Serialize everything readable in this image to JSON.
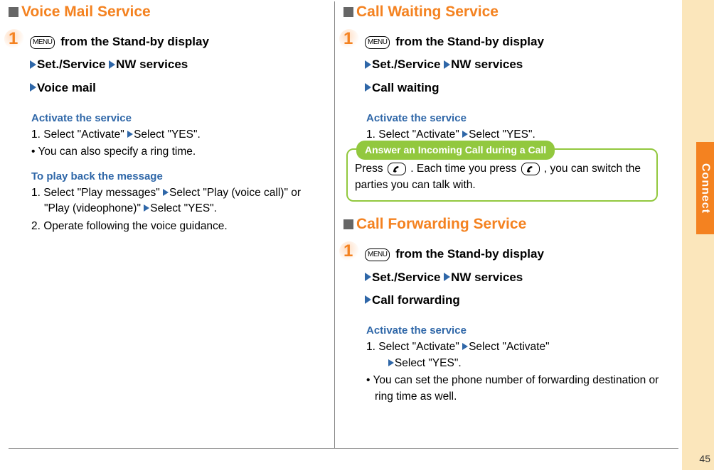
{
  "page_number": "45",
  "side_tab": "Connect",
  "menu_label": "MENU",
  "left": {
    "section_title": "Voice Mail Service",
    "step1": {
      "num": "1",
      "line1_after_menu": "from the Stand-by display",
      "part1": "Set./Service",
      "part2": "NW services",
      "part3": "Voice mail"
    },
    "sub1": {
      "title": "Activate the service",
      "item1": "1. Select \"Activate\"",
      "item1_after": "Select \"YES\".",
      "note": " • You can also specify a ring time."
    },
    "sub2": {
      "title": "To play back the message",
      "item1": "1. Select \"Play messages\"",
      "item1_after": "Select \"Play (voice call)\" or \"Play (videophone)\"",
      "item1_after2": "Select \"YES\".",
      "item2": "2. Operate following the voice guidance."
    }
  },
  "right": {
    "sectionA_title": "Call Waiting Service",
    "stepA1": {
      "num": "1",
      "line1_after_menu": "from the Stand-by display",
      "part1": "Set./Service",
      "part2": "NW services",
      "part3": "Call waiting"
    },
    "subA1": {
      "title": "Activate the service",
      "item1": "1. Select \"Activate\"",
      "item1_after": "Select \"YES\"."
    },
    "callout": {
      "title": "Answer an Incoming Call during a Call",
      "text1": "Press ",
      "text2": ". Each time you press ",
      "text3": ", you can switch the parties you can talk with."
    },
    "sectionB_title": "Call Forwarding Service",
    "stepB1": {
      "num": "1",
      "line1_after_menu": "from the Stand-by display",
      "part1": "Set./Service",
      "part2": "NW services",
      "part3": "Call forwarding"
    },
    "subB1": {
      "title": "Activate the service",
      "item1": "1. Select \"Activate\"",
      "item1_after": "Select \"Activate\"",
      "item1_after2": "Select \"YES\".",
      "note": " • You can set the phone number of forwarding destination or ring time as well."
    }
  }
}
